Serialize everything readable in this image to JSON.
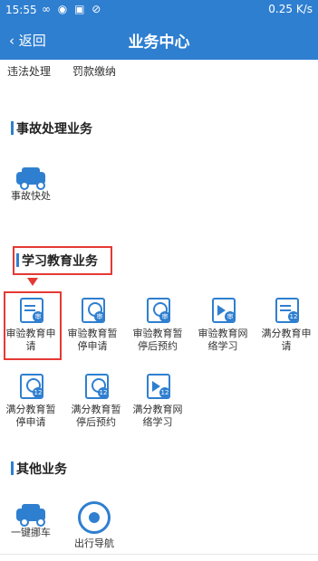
{
  "status_bar": {
    "time": "15:55",
    "right": "0.25 K/s"
  },
  "header": {
    "back_label": "返回",
    "title": "业务中心"
  },
  "top_links": [
    "违法处理",
    "罚款缴纳"
  ],
  "sections": {
    "accident": {
      "title": "事故处理业务",
      "items": [
        {
          "label": "事故快处"
        }
      ]
    },
    "education": {
      "title": "学习教育业务",
      "items": [
        {
          "label": "审验教育申请"
        },
        {
          "label": "审验教育暂停申请"
        },
        {
          "label": "审验教育暂停后预约"
        },
        {
          "label": "审验教育网络学习"
        },
        {
          "label": "满分教育申请"
        },
        {
          "label": "满分教育暂停申请"
        },
        {
          "label": "满分教育暂停后预约"
        },
        {
          "label": "满分教育网络学习"
        }
      ]
    },
    "other": {
      "title": "其他业务",
      "items": [
        {
          "label": "一键挪车"
        },
        {
          "label": "出行导航"
        }
      ]
    }
  },
  "colors": {
    "primary": "#2f7fd0",
    "highlight": "#e53935"
  }
}
